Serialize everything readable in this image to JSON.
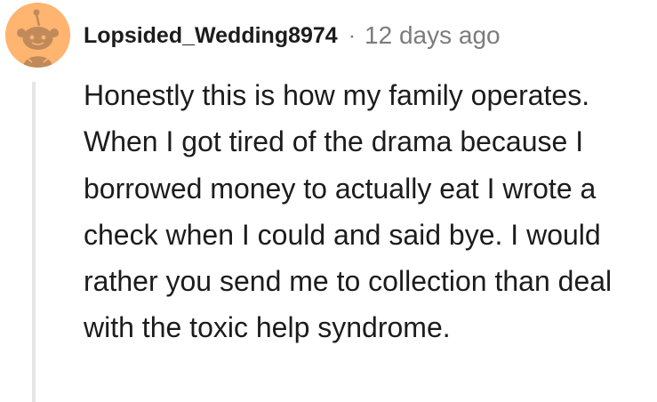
{
  "comment": {
    "author": "Lopsided_Wedding8974",
    "separator": "·",
    "timestamp": "12 days ago",
    "body": "Honestly this is how my family operates. When I got tired of the drama because I borrowed money to actually eat I wrote a check when I could and said bye. I would rather you send me to collection than deal with the toxic help syndrome.",
    "avatar_icon": "snoo-avatar-icon"
  },
  "colors": {
    "avatar_background": "#FFB470",
    "avatar_figure": "#C08A5B",
    "username": "#1c1c1c",
    "meta": "#7c7c7c",
    "body_text": "#1c1c1c",
    "thread_line": "#e5e5e5"
  }
}
